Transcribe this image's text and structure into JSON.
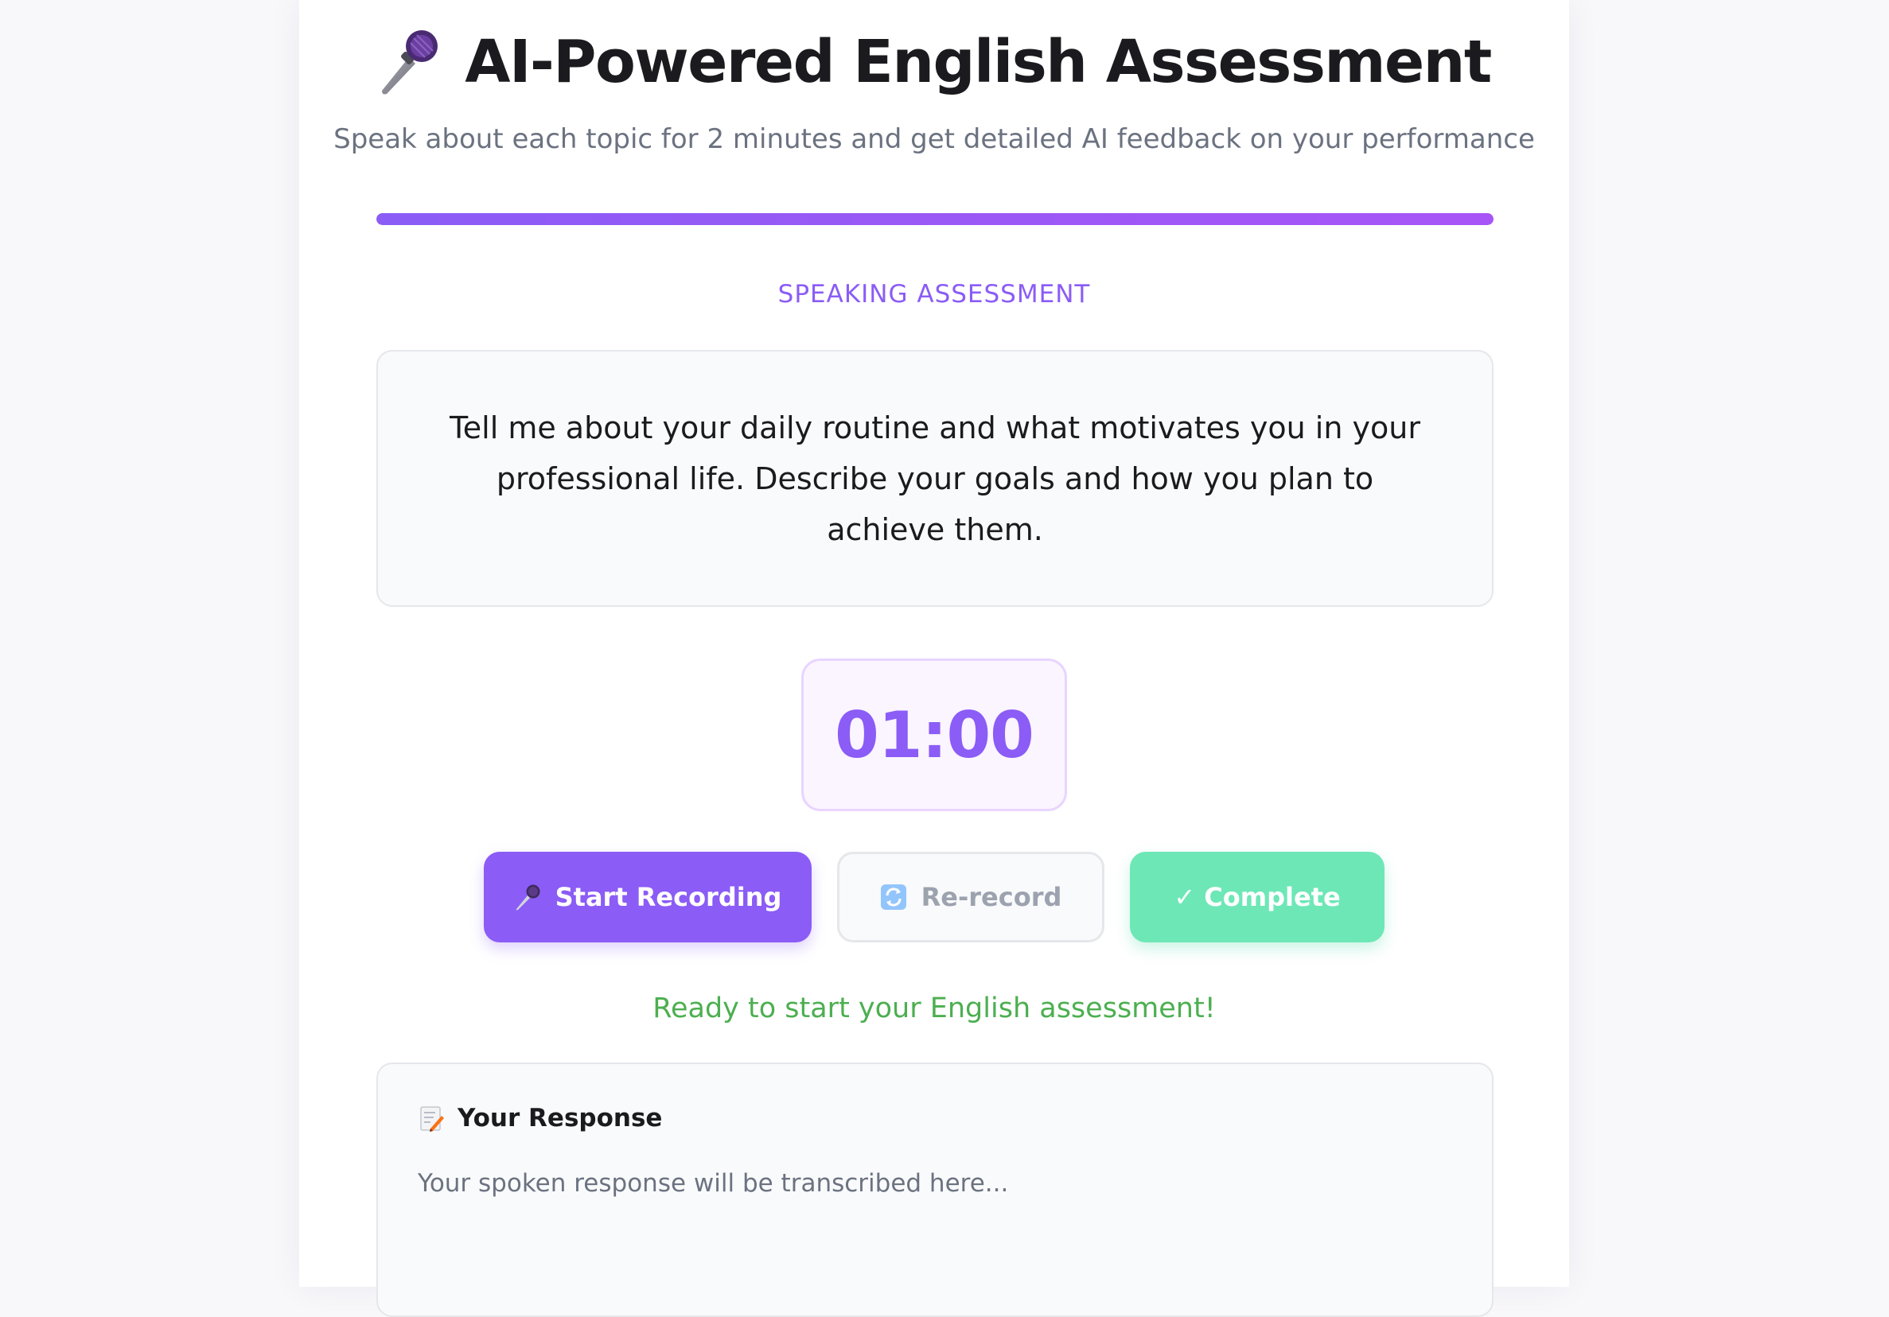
{
  "header": {
    "title": "AI-Powered English Assessment",
    "subtitle": "Speak about each topic for 2 minutes and get detailed AI feedback on your performance",
    "title_icon": "microphone-icon"
  },
  "progress": {
    "percent": 100
  },
  "section": {
    "label": "SPEAKING ASSESSMENT"
  },
  "prompt": {
    "text": "Tell me about your daily routine and what motivates you in your professional life. Describe your goals and how you plan to achieve them."
  },
  "timer": {
    "display": "01:00"
  },
  "controls": {
    "start_label": "Start Recording",
    "start_icon": "microphone-icon",
    "rerecord_label": "Re-record",
    "rerecord_icon": "repeat-icon",
    "complete_label": "✓ Complete"
  },
  "status": {
    "message": "Ready to start your English assessment!"
  },
  "response": {
    "title": "Your Response",
    "title_icon": "memo-icon",
    "placeholder": "Your spoken response will be transcribed here..."
  },
  "colors": {
    "accent": "#8b5cf6",
    "success_text": "#4caf50",
    "complete_button": "#6ee7b7",
    "muted_text": "#6b7280"
  }
}
